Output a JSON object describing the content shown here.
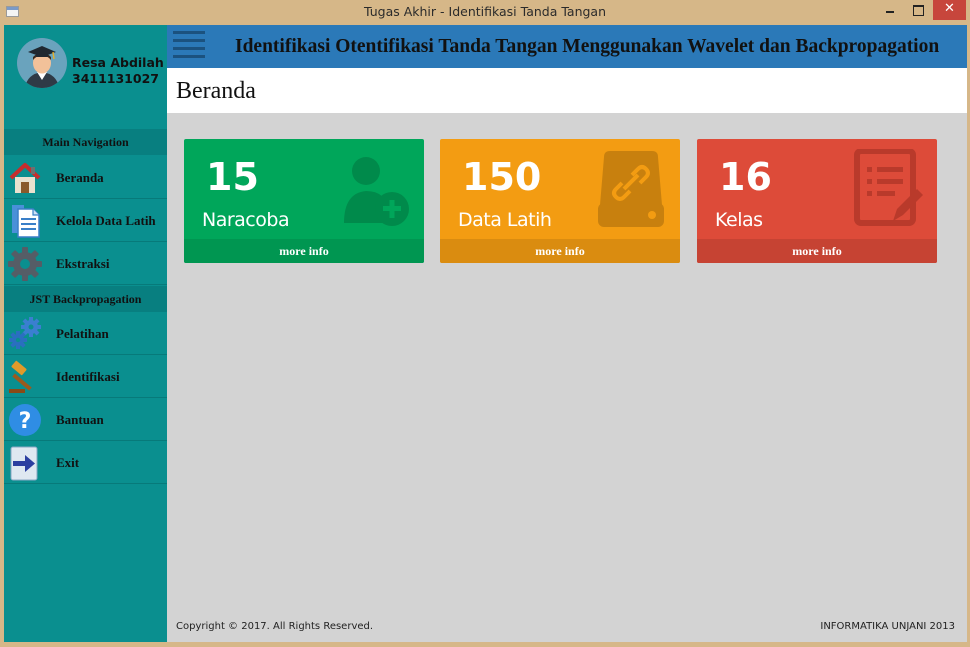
{
  "window": {
    "title": "Tugas Akhir - Identifikasi Tanda Tangan",
    "close_symbol": "✕"
  },
  "profile": {
    "name": "Resa Abdilah",
    "nim": "3411131027",
    "avatar_icon": "graduate-avatar-icon"
  },
  "sidebar": {
    "sections": [
      {
        "title": "Main Navigation",
        "items": [
          {
            "label": "Beranda",
            "icon": "home-icon"
          },
          {
            "label": "Kelola Data Latih",
            "icon": "document-icon"
          },
          {
            "label": "Ekstraksi",
            "icon": "gear-icon"
          }
        ]
      },
      {
        "title": "JST Backpropagation",
        "items": [
          {
            "label": "Pelatihan",
            "icon": "gears-icon"
          },
          {
            "label": "Identifikasi",
            "icon": "gavel-icon"
          },
          {
            "label": "Bantuan",
            "icon": "help-icon"
          },
          {
            "label": "Exit",
            "icon": "exit-arrow-icon"
          }
        ]
      }
    ]
  },
  "header": {
    "app_title": "Identifikasi Otentifikasi Tanda Tangan Menggunakan Wavelet dan Backpropagation",
    "page_title": "Beranda"
  },
  "cards": [
    {
      "count": "15",
      "label": "Naracoba",
      "more": "more info",
      "icon": "add-user-icon",
      "color": "#00a65a"
    },
    {
      "count": "150",
      "label": "Data Latih",
      "more": "more info",
      "icon": "database-link-icon",
      "color": "#f39c12"
    },
    {
      "count": "16",
      "label": "Kelas",
      "more": "more info",
      "icon": "edit-list-icon",
      "color": "#dd4b39"
    }
  ],
  "footer": {
    "copyright": "Copyright © 2017.  All Rights Reserved.",
    "institution": "INFORMATIKA UNJANI 2013"
  },
  "colors": {
    "sidebar": "#0a8f8f",
    "topbar": "#2b79b8",
    "content_bg": "#d3d3d3",
    "window_chrome": "#d6b788"
  }
}
